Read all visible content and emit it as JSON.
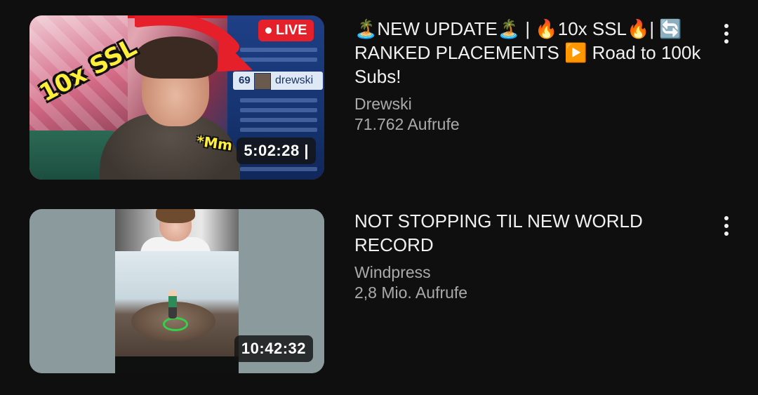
{
  "videos": [
    {
      "title": "🏝️NEW UPDATE🏝️ | 🔥10x  SSL🔥| 🔄 RANKED PLACEMENTS ▶️ Road to 100k Subs!",
      "channel": "Drewski",
      "views": "71.762 Aufrufe",
      "duration": "5:02:28 |",
      "badge": "LIVE",
      "thumbnail_text": {
        "overlay": "10x SSL",
        "caption": "*Mm",
        "scoreboard_number": "69",
        "scoreboard_name": "drewski"
      },
      "menu_icon": "more-vert-icon"
    },
    {
      "title": "NOT STOPPING TIL NEW WORLD RECORD",
      "channel": "Windpress",
      "views": "2,8 Mio. Aufrufe",
      "duration": "10:42:32",
      "menu_icon": "more-vert-icon"
    }
  ],
  "colors": {
    "background": "#0f0f0f",
    "title_text": "#f1f1f1",
    "secondary_text": "#aaaaaa",
    "live_badge": "#e5202a",
    "overlay_yellow": "#ffef3a"
  }
}
